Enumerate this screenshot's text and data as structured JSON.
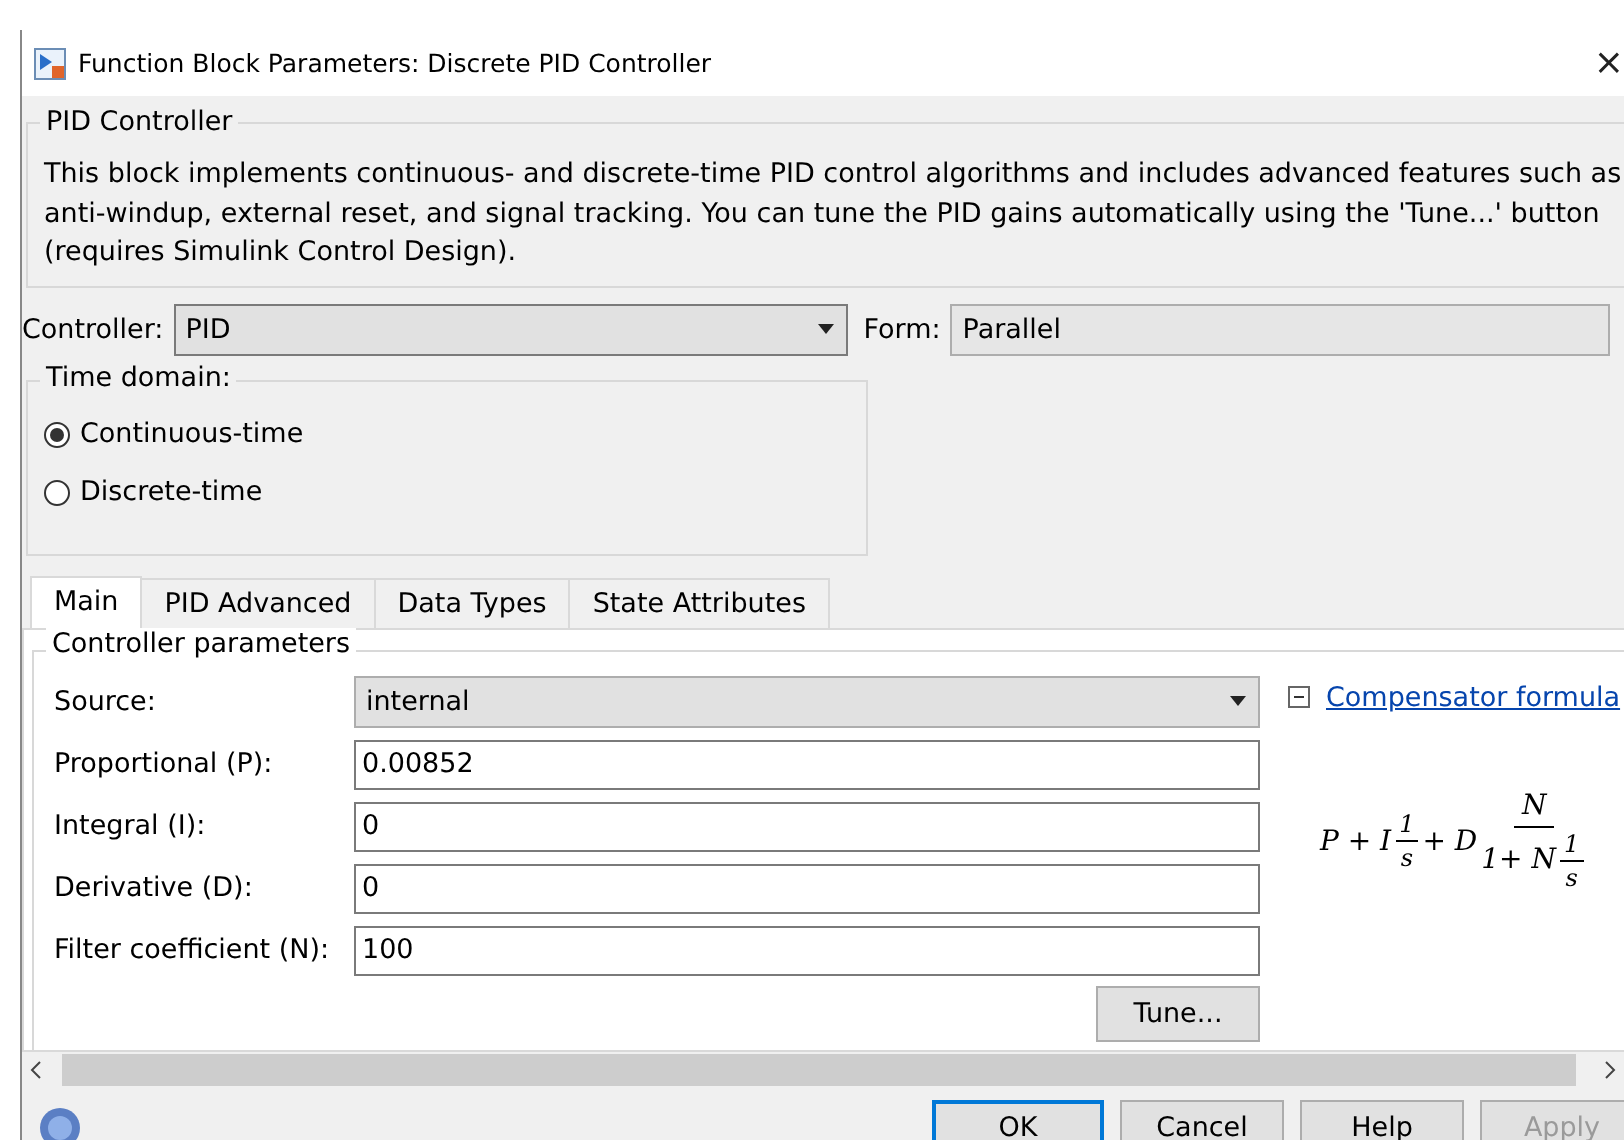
{
  "window": {
    "title": "Function Block Parameters: Discrete PID Controller",
    "close": "×"
  },
  "block": {
    "title": "PID Controller",
    "description": "This block implements continuous- and discrete-time PID control algorithms and includes advanced features such as anti-windup, external reset, and signal tracking. You can tune the PID gains automatically using the 'Tune...' button (requires Simulink Control Design)."
  },
  "controller": {
    "label": "Controller:",
    "value": "PID"
  },
  "form": {
    "label": "Form:",
    "value": "Parallel"
  },
  "time_domain": {
    "title": "Time domain:",
    "options": [
      {
        "label": "Continuous-time",
        "selected": true
      },
      {
        "label": "Discrete-time",
        "selected": false
      }
    ]
  },
  "tabs": [
    {
      "label": "Main",
      "selected": true
    },
    {
      "label": "PID Advanced",
      "selected": false
    },
    {
      "label": "Data Types",
      "selected": false
    },
    {
      "label": "State Attributes",
      "selected": false
    }
  ],
  "parameters": {
    "title": "Controller parameters",
    "rows": [
      {
        "kind": "dropdown",
        "label": "Source:",
        "value": "internal"
      },
      {
        "kind": "input",
        "label": "Proportional (P):",
        "value": "0.00852"
      },
      {
        "kind": "input",
        "label": "Integral (I):",
        "value": "0"
      },
      {
        "kind": "input",
        "label": "Derivative (D):",
        "value": "0"
      },
      {
        "kind": "input",
        "label": "Filter coefficient (N):",
        "value": "100"
      }
    ],
    "tune": "Tune...",
    "formula_link": {
      "label": "Compensator formula",
      "expanded": true
    },
    "formula": {
      "lead": "P + I",
      "frac1": {
        "num": "1",
        "den": "s"
      },
      "mid": "+ D",
      "frac2": {
        "num": "N",
        "den_lead": "1+ N",
        "den_frac": {
          "num": "1",
          "den": "s"
        }
      }
    }
  },
  "buttons": [
    {
      "label": "OK",
      "disabled": false,
      "default": true
    },
    {
      "label": "Cancel",
      "disabled": false,
      "default": false
    },
    {
      "label": "Help",
      "disabled": false,
      "default": false
    },
    {
      "label": "Apply",
      "disabled": true,
      "default": false
    }
  ]
}
